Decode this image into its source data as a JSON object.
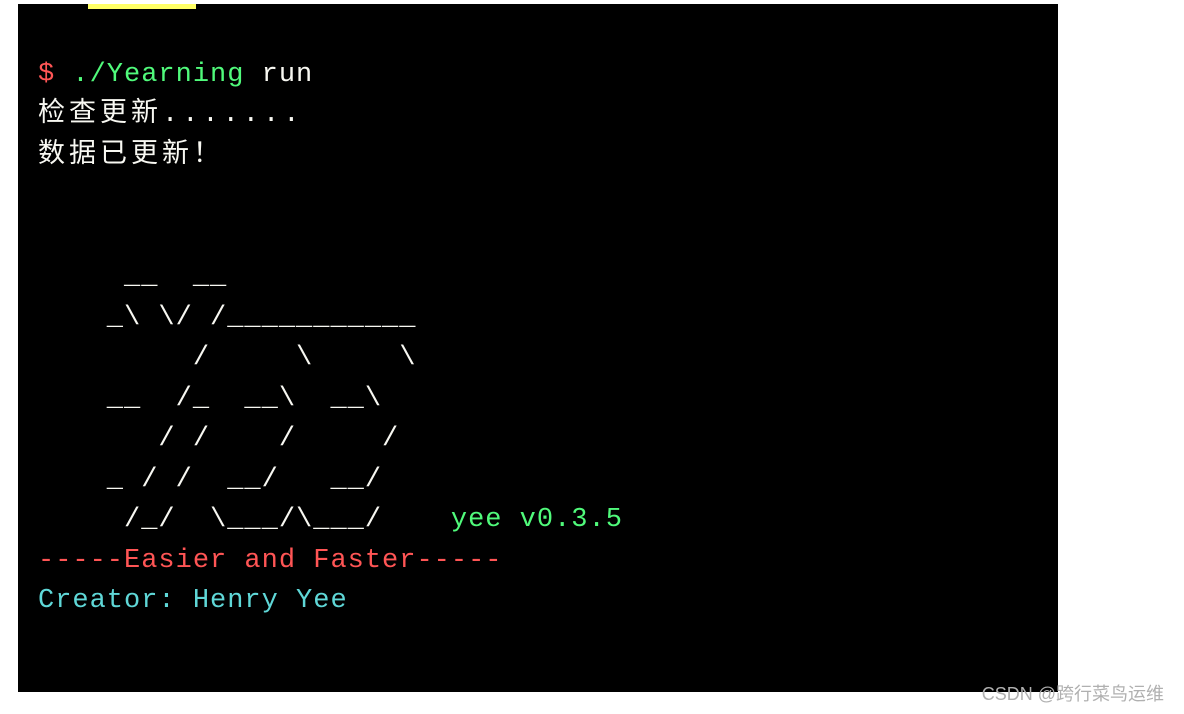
{
  "prompt": {
    "symbol": "$ ",
    "command": "./Yearning",
    "arg": " run"
  },
  "output": {
    "line1": "检查更新.......",
    "line2": "数据已更新！"
  },
  "ascii": {
    "l1": "     __  __",
    "l2": "    _\\ \\/ /___________",
    "l3": "         /     \\     \\",
    "l4": "    __  /_  __\\  __\\",
    "l5": "       / /    /     /",
    "l6": "    _ / /  __/   __/",
    "l7": "     /_/  \\___/\\___/    ",
    "version": "yee v0.3.5"
  },
  "tagline": "-----Easier and Faster-----",
  "creator": "Creator: Henry Yee",
  "watermark": "CSDN @跨行菜鸟运维"
}
